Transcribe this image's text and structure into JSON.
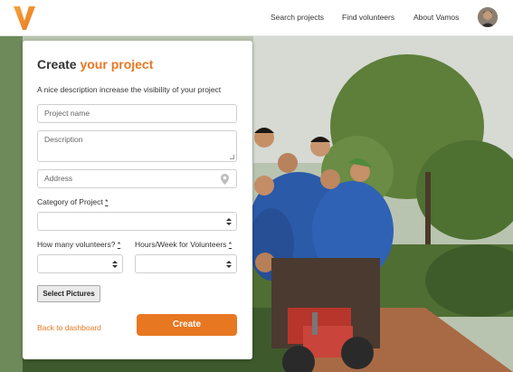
{
  "nav": {
    "links": [
      "Search projects",
      "Find volunteers",
      "About Vamos"
    ]
  },
  "form": {
    "title_main": "Create ",
    "title_accent": "your project",
    "subtitle": "A nice description increase the visibility of your project",
    "project_name_placeholder": "Project name",
    "description_placeholder": "Description",
    "address_placeholder": "Address",
    "category_label": "Category of Project ",
    "volunteers_label": "How many volunteers? ",
    "hours_label": "Hours/Week for Volunteers ",
    "required_mark": "*",
    "select_pictures_label": "Select Pictures",
    "back_label": "Back to dashboard",
    "create_label": "Create"
  },
  "colors": {
    "accent": "#e87722"
  }
}
